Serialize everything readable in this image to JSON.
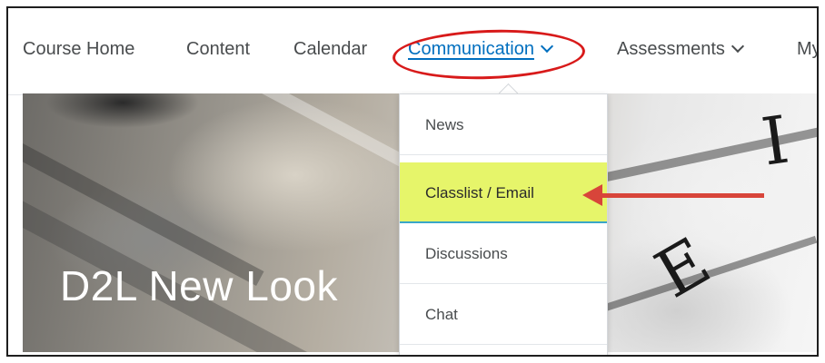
{
  "nav": {
    "items": [
      {
        "label": "Course Home"
      },
      {
        "label": "Content"
      },
      {
        "label": "Calendar"
      },
      {
        "label": "Communication"
      },
      {
        "label": "Assessments"
      },
      {
        "label": "My"
      }
    ]
  },
  "hero": {
    "title": "D2L New Look"
  },
  "dropdown": {
    "items": [
      {
        "label": "News"
      },
      {
        "label": "Classlist / Email"
      },
      {
        "label": "Discussions"
      },
      {
        "label": "Chat"
      }
    ]
  },
  "colors": {
    "link": "#006fbf",
    "highlight": "#e6f56a",
    "annotation": "#d81a1a"
  }
}
